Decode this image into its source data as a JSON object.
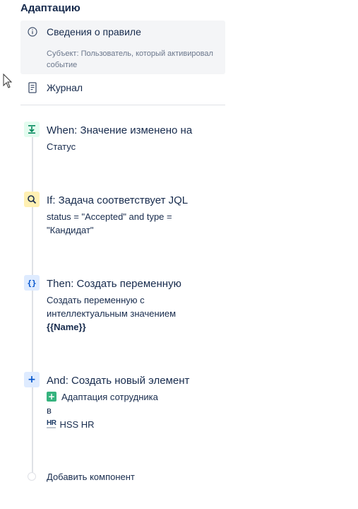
{
  "header": {
    "title": "Адаптацию"
  },
  "rule_details": {
    "title": "Сведения о правиле",
    "subtitle": "Субъект: Пользователь, который активировал событие"
  },
  "log": {
    "label": "Журнал"
  },
  "steps": {
    "when": {
      "title": "When: Значение изменено на",
      "detail": "Статус"
    },
    "if": {
      "title": "If: Задача соответствует JQL",
      "detail": "status = \"Accepted\" and type = \"Кандидат\""
    },
    "then": {
      "title": "Then: Создать переменную",
      "detail": "Создать переменную с интеллектуальным значением",
      "variable": "{{Name}}"
    },
    "and": {
      "title": "And: Создать новый элемент",
      "issue_type": "Адаптация сотрудника",
      "in_label": "в",
      "project_icon_text": "HR",
      "project": "HSS HR"
    }
  },
  "add_component": {
    "label": "Добавить компонент"
  },
  "colors": {
    "text": "#172b4d",
    "muted": "#6b778c",
    "panel": "#f4f5f7",
    "trigger": "#00875a",
    "condition": "#fff0b3",
    "action": "#0052cc"
  }
}
